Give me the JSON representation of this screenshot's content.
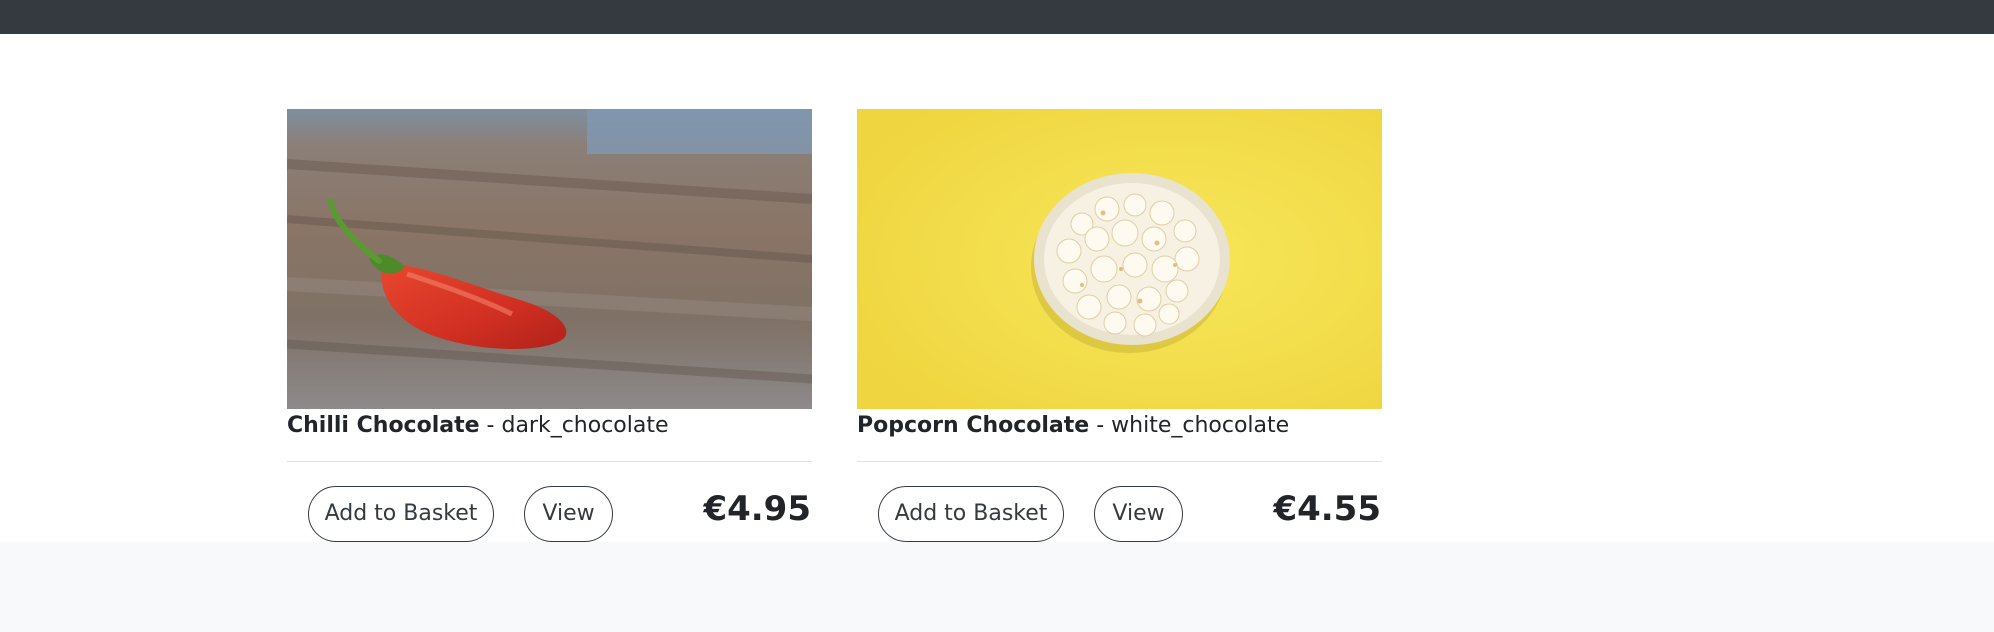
{
  "products": [
    {
      "name": "Chilli Chocolate",
      "separator": " - ",
      "category": "dark_chocolate",
      "add_label": "Add to Basket",
      "view_label": "View",
      "price": "€4.95"
    },
    {
      "name": "Popcorn Chocolate",
      "separator": " - ",
      "category": "white_chocolate",
      "add_label": "Add to Basket",
      "view_label": "View",
      "price": "€4.55"
    }
  ],
  "colors": {
    "navbar": "#343a40",
    "footer": "#f8f9fa",
    "popcorn_background": "#f2dc4a",
    "chilli_red": "#d93a2b"
  }
}
